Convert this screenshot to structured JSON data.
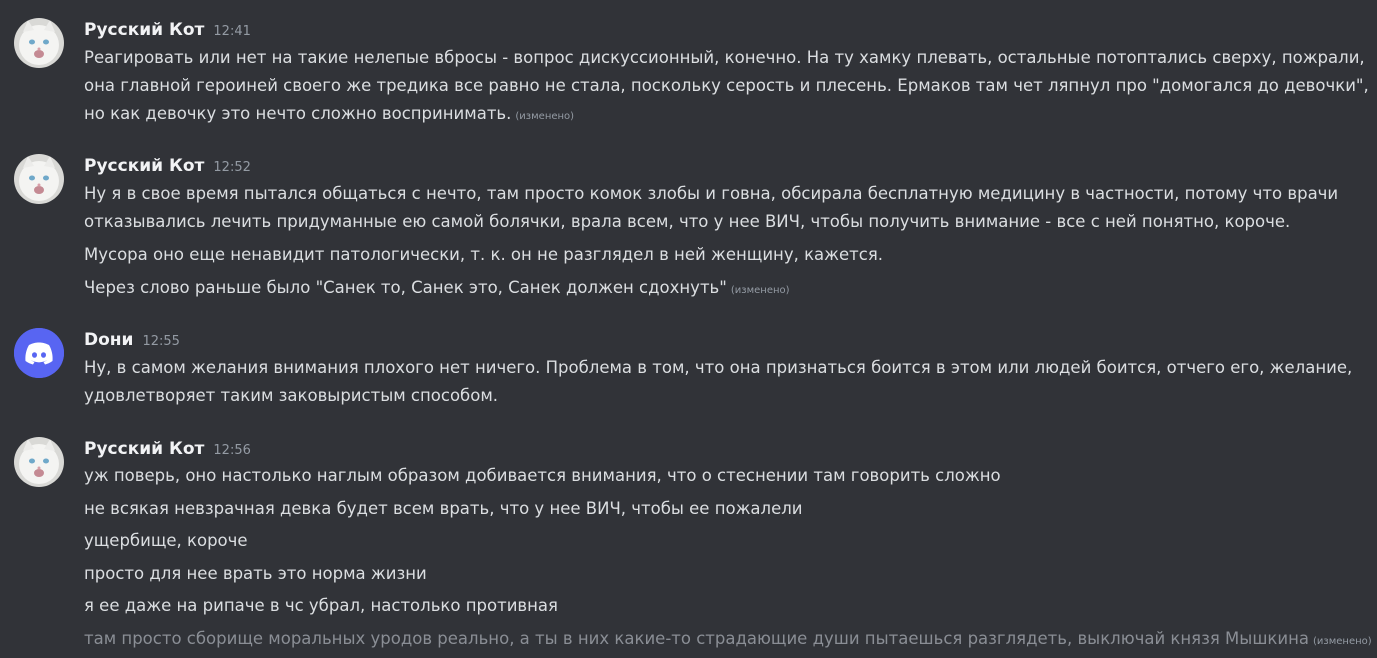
{
  "edited_label": "(изменено)",
  "messages": [
    {
      "username": "Русский Кот",
      "time": "12:41",
      "avatar": "white-cat-avatar",
      "lines": [
        "Реагировать или нет на такие нелепые вбросы - вопрос дискуссионный, конечно. На ту хамку плевать, остальные потоптались сверху, пожрали,",
        "она главной героиней своего же тредика все равно не стала, поскольку серость и плесень. Ермаков там чет ляпнул про \"домогался до девочки\",",
        "но как девочку это  нечто сложно воспринимать."
      ]
    },
    {
      "username": "Русский Кот",
      "time": "12:52",
      "avatar": "white-cat-avatar",
      "lines": [
        "Ну я в свое время пытался общаться с нечто, там просто комок злобы и говна, обсирала бесплатную медицину в частности, потому что врачи",
        "отказывались лечить придуманные ею самой болячки, врала всем, что у нее ВИЧ, чтобы получить внимание - все с ней понятно, короче.",
        "Мусора оно еще ненавидит патологически, т. к. он не разглядел в ней женщину, кажется.",
        "Через слово раньше было \"Санек то, Санек это, Санек должен сдохнуть\""
      ]
    },
    {
      "username": "Doни",
      "time": "12:55",
      "avatar": "discord-default-avatar",
      "avatar_color": "#5865f2",
      "lines": [
        "Ну, в самом желания внимания плохого нет ничего. Проблема в том, что она признаться боится в этом или людей боится, отчего его, желание,",
        "удовлетворяет таким заковыристым способом."
      ]
    },
    {
      "username": "Русский Кот",
      "time": "12:56",
      "avatar": "white-cat-avatar",
      "lines": [
        "уж поверь, оно настолько наглым образом добивается внимания, что о стеснении там говорить сложно",
        "не всякая невзрачная девка будет всем врать, что у нее ВИЧ, чтобы ее пожалели",
        "ущербище, короче",
        "просто для нее врать это норма жизни",
        "я ее даже на рипаче в чс убрал, настолько противная",
        "там просто сборище моральных уродов реально, а ты в них какие-то страдающие души пытаешься разглядеть, выключай князя Мышкина"
      ]
    }
  ],
  "colors": {
    "background": "#313338",
    "username": "#f2f3f5",
    "text": "#dbdee1",
    "muted": "#949ba4",
    "blurple": "#5865f2"
  }
}
